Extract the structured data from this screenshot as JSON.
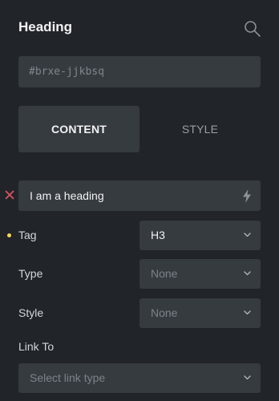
{
  "panel": {
    "title": "Heading",
    "element_id": "#brxe-jjkbsq"
  },
  "tabs": [
    {
      "label": "CONTENT",
      "active": true
    },
    {
      "label": "STYLE",
      "active": false
    }
  ],
  "text_control": {
    "value": "I am a heading"
  },
  "controls": {
    "tag": {
      "label": "Tag",
      "value": "H3"
    },
    "type": {
      "label": "Type",
      "placeholder": "None"
    },
    "style": {
      "label": "Style",
      "placeholder": "None"
    },
    "link_to": {
      "label": "Link To",
      "placeholder": "Select link type"
    }
  },
  "colors": {
    "background": "#212428",
    "control_bg": "#363b40",
    "remove_x": "#e05563",
    "set_indicator": "#ffd64f"
  }
}
